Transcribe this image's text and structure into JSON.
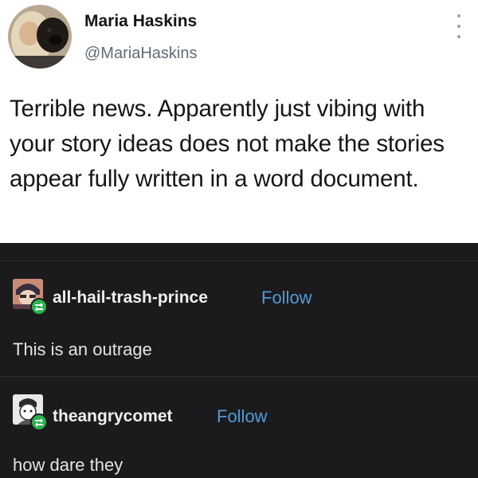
{
  "tweet": {
    "author_name": "Maria Haskins",
    "author_handle": "@MariaHaskins",
    "body": "Terrible news. Apparently just vibing with your story ideas does not make the stories appear fully written in a word document.",
    "avatar_icon": "profile-photo-woman-with-dog",
    "menu_icon": "vertical-ellipsis-icon"
  },
  "reblogs": [
    {
      "username": "all-hail-trash-prince",
      "follow_label": "Follow",
      "text": "This is an outrage",
      "avatar_icon": "anime-character-avatar",
      "badge_icon": "reblog-icon"
    },
    {
      "username": "theangrycomet",
      "follow_label": "Follow",
      "text": "how dare they",
      "avatar_icon": "sketch-character-avatar",
      "badge_icon": "reblog-icon"
    }
  ],
  "colors": {
    "tumblr_background": "#1b1b1d",
    "follow_link": "#4f9bd8",
    "reblog_badge": "#2bb24c"
  }
}
